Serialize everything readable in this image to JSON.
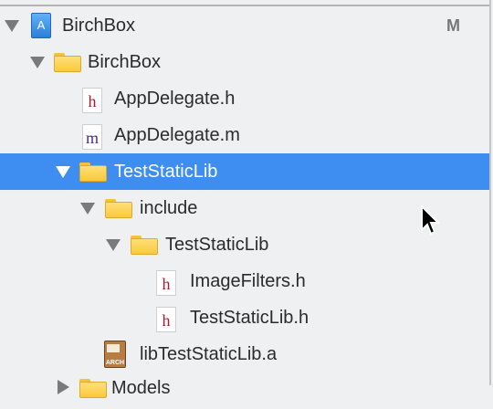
{
  "tree": [
    {
      "label": "BirchBox",
      "icon": "xcode-project-icon",
      "expanded": true,
      "status": "M"
    },
    {
      "label": "BirchBox",
      "icon": "folder-icon",
      "expanded": true
    },
    {
      "label": "AppDelegate.h",
      "icon": "header-file-icon",
      "glyph": "h"
    },
    {
      "label": "AppDelegate.m",
      "icon": "objc-file-icon",
      "glyph": "m"
    },
    {
      "label": "TestStaticLib",
      "icon": "folder-icon",
      "expanded": true,
      "selected": true
    },
    {
      "label": "include",
      "icon": "folder-icon",
      "expanded": true
    },
    {
      "label": "TestStaticLib",
      "icon": "folder-icon",
      "expanded": true
    },
    {
      "label": "ImageFilters.h",
      "icon": "header-file-icon",
      "glyph": "h"
    },
    {
      "label": "TestStaticLib.h",
      "icon": "header-file-icon",
      "glyph": "h"
    },
    {
      "label": "libTestStaticLib.a",
      "icon": "static-library-icon",
      "icon_text": "ARCH"
    },
    {
      "label": "Models",
      "icon": "folder-icon",
      "expanded": false
    }
  ],
  "colors": {
    "selection": "#3d8ef0",
    "header_glyph": "#a51c30",
    "impl_glyph": "#4b2c8c"
  }
}
